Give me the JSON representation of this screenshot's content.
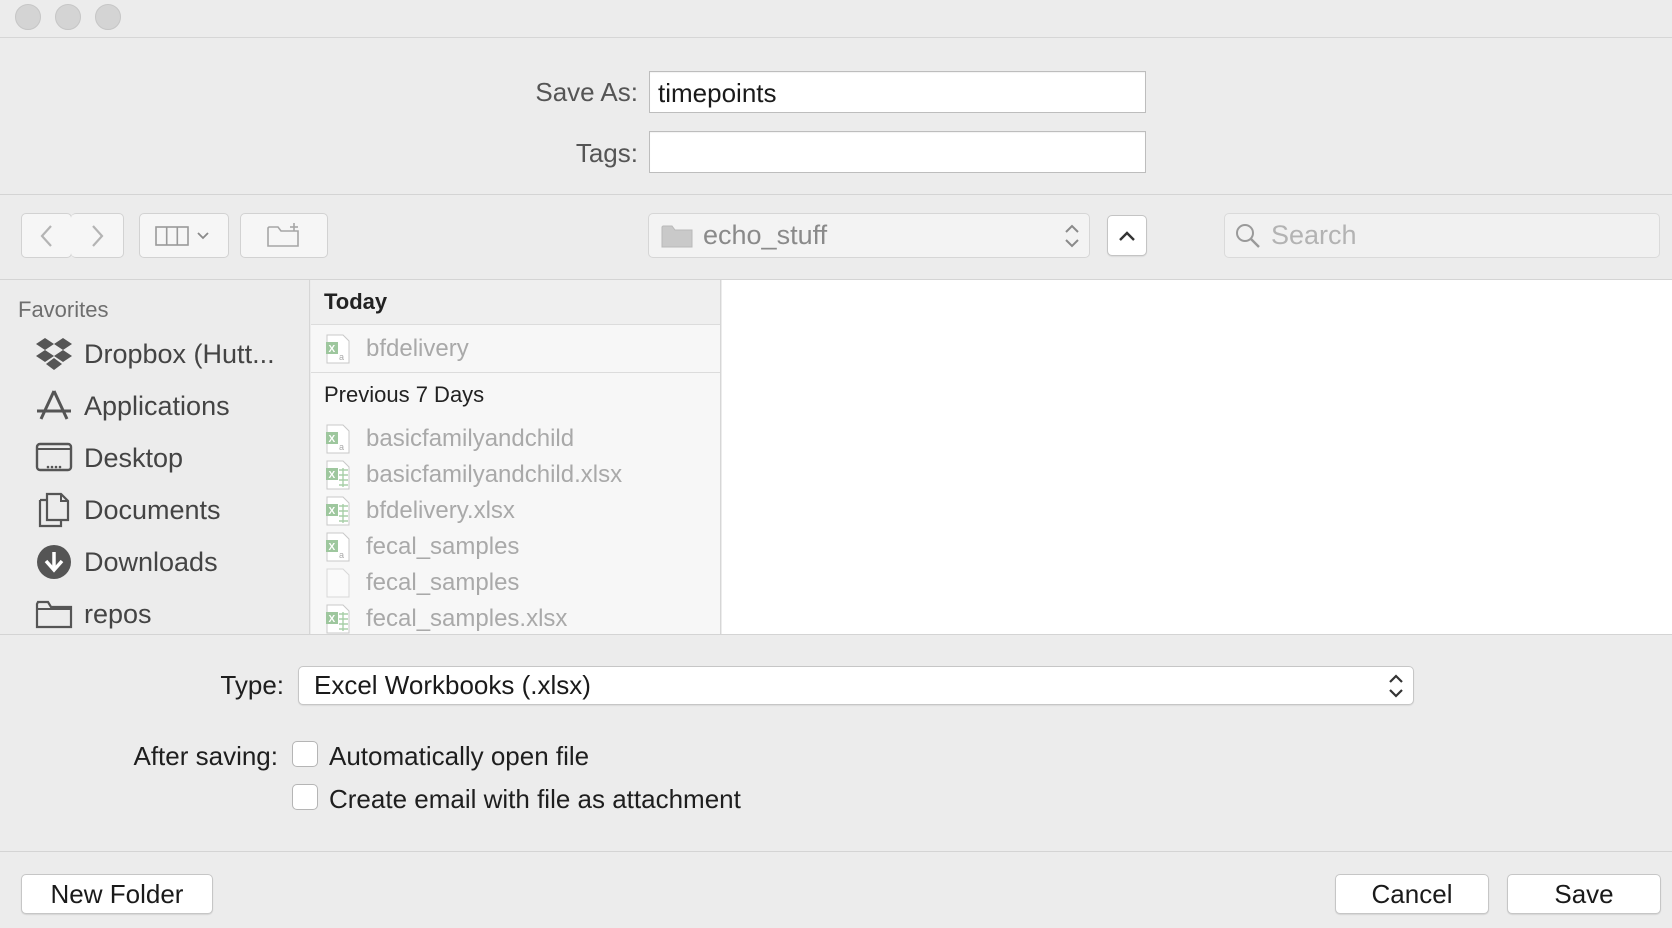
{
  "form": {
    "save_as_label": "Save As:",
    "save_as_value": "timepoints",
    "tags_label": "Tags:",
    "tags_value": ""
  },
  "toolbar": {
    "location": "echo_stuff",
    "search_placeholder": "Search"
  },
  "sidebar": {
    "heading": "Favorites",
    "items": [
      {
        "label": "Dropbox (Hutt...",
        "icon": "dropbox-icon"
      },
      {
        "label": "Applications",
        "icon": "applications-icon"
      },
      {
        "label": "Desktop",
        "icon": "desktop-icon"
      },
      {
        "label": "Documents",
        "icon": "documents-icon"
      },
      {
        "label": "Downloads",
        "icon": "downloads-icon"
      },
      {
        "label": "repos",
        "icon": "folder-icon"
      }
    ]
  },
  "files": {
    "groups": [
      {
        "header": "Today",
        "items": [
          {
            "name": "bfdelivery",
            "icon": "excel-doc-icon"
          }
        ]
      },
      {
        "header": "Previous 7 Days",
        "items": [
          {
            "name": "basicfamilyandchild",
            "icon": "excel-doc-icon"
          },
          {
            "name": "basicfamilyandchild.xlsx",
            "icon": "excel-sheet-icon"
          },
          {
            "name": "bfdelivery.xlsx",
            "icon": "excel-sheet-icon"
          },
          {
            "name": "fecal_samples",
            "icon": "excel-doc-icon"
          },
          {
            "name": "fecal_samples",
            "icon": "blank-doc-icon"
          },
          {
            "name": "fecal_samples.xlsx",
            "icon": "excel-sheet-icon"
          }
        ]
      }
    ]
  },
  "options": {
    "type_label": "Type:",
    "type_value": "Excel Workbooks (.xlsx)",
    "after_saving_label": "After saving:",
    "auto_open_label": "Automatically open file",
    "auto_open_checked": false,
    "email_label": "Create email with file as attachment",
    "email_checked": false
  },
  "buttons": {
    "new_folder": "New Folder",
    "cancel": "Cancel",
    "save": "Save"
  }
}
